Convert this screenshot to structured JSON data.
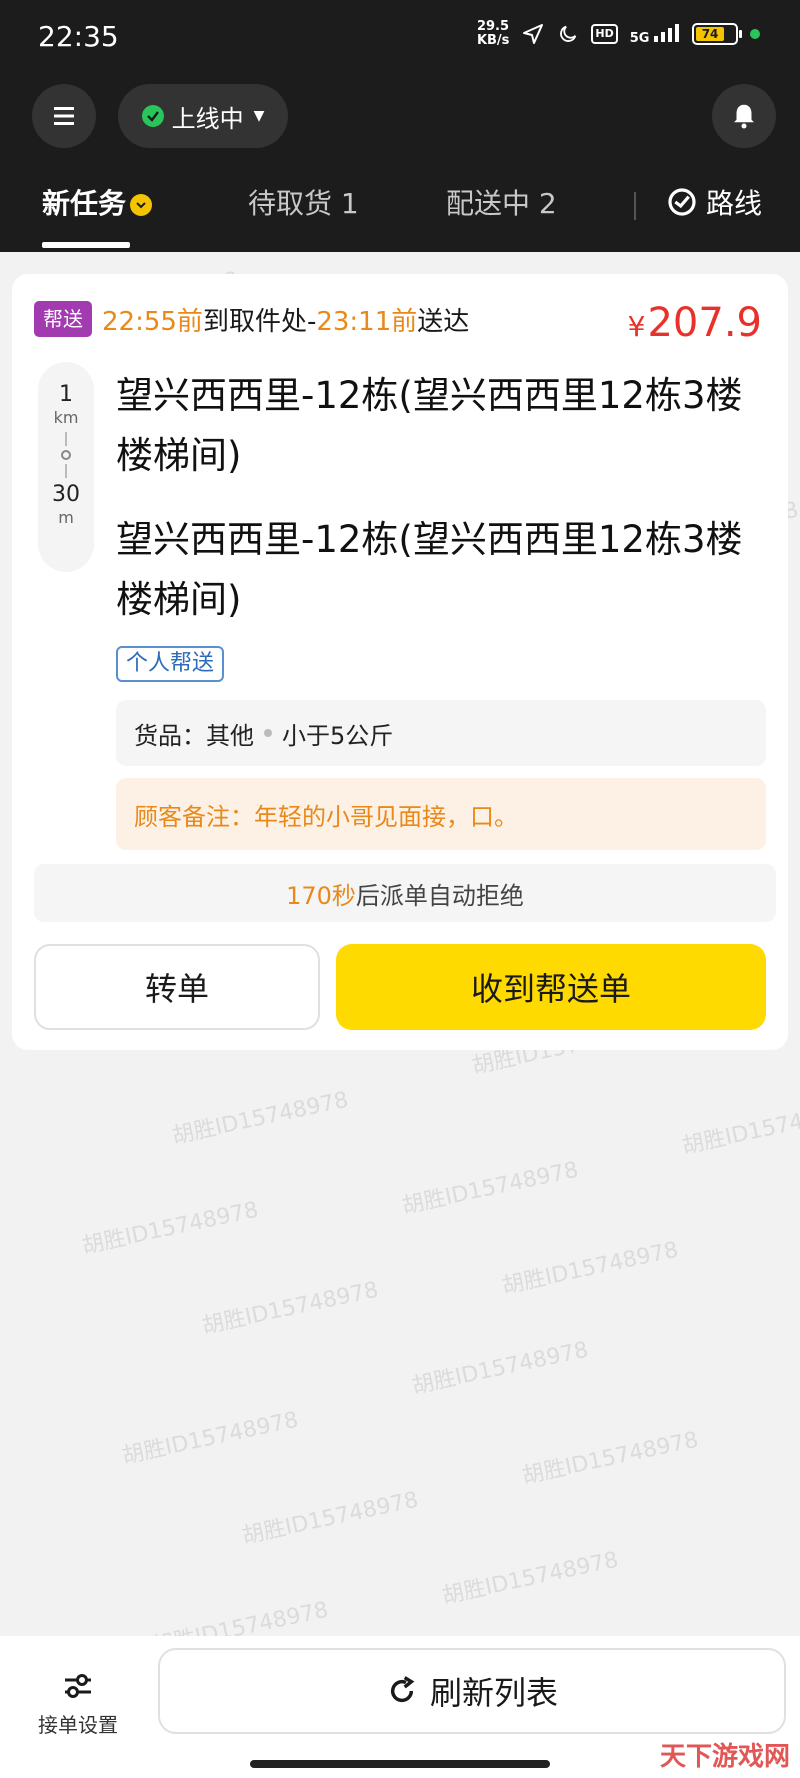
{
  "status_bar": {
    "time": "22:35",
    "net_speed_value": "29.5",
    "net_speed_unit": "KB/s",
    "hd": "HD",
    "network": "5G",
    "battery": "74"
  },
  "header": {
    "online_status": "上线中"
  },
  "tabs": {
    "new": "新任务",
    "pickup": "待取货 1",
    "delivering": "配送中 2",
    "route": "路线"
  },
  "order": {
    "type": "帮送",
    "pickup_time": "22:55前",
    "pickup_text": "到取件处-",
    "deliver_time": "23:11前",
    "deliver_text": "送达",
    "price_symbol": "¥",
    "price": "207.9",
    "distance1_value": "1",
    "distance1_unit": "km",
    "distance2_value": "30",
    "distance2_unit": "m",
    "pickup_address": "望兴西西里-12栋(望兴西西里12栋3楼楼梯间)",
    "dropoff_address": "望兴西西里-12栋(望兴西西里12栋3楼楼梯间)",
    "tag": "个人帮送",
    "goods_label": "货品：其他",
    "goods_weight": "小于5公斤",
    "note": "顾客备注：年轻的小哥见面接，口。",
    "countdown_value": "170秒",
    "countdown_text": "后派单自动拒绝",
    "transfer_button": "转单",
    "accept_button": "收到帮送单"
  },
  "watermark": "胡胜ID15748978",
  "bottom": {
    "settings_label": "接单设置",
    "refresh_label": "刷新列表"
  },
  "corner_logo": "天下游戏网",
  "colors": {
    "header_bg": "#1c1c1c",
    "accent_yellow": "#ffda00",
    "price_red": "#e8312a",
    "time_orange": "#e8891a",
    "badge_purple": "#a23ab0"
  }
}
